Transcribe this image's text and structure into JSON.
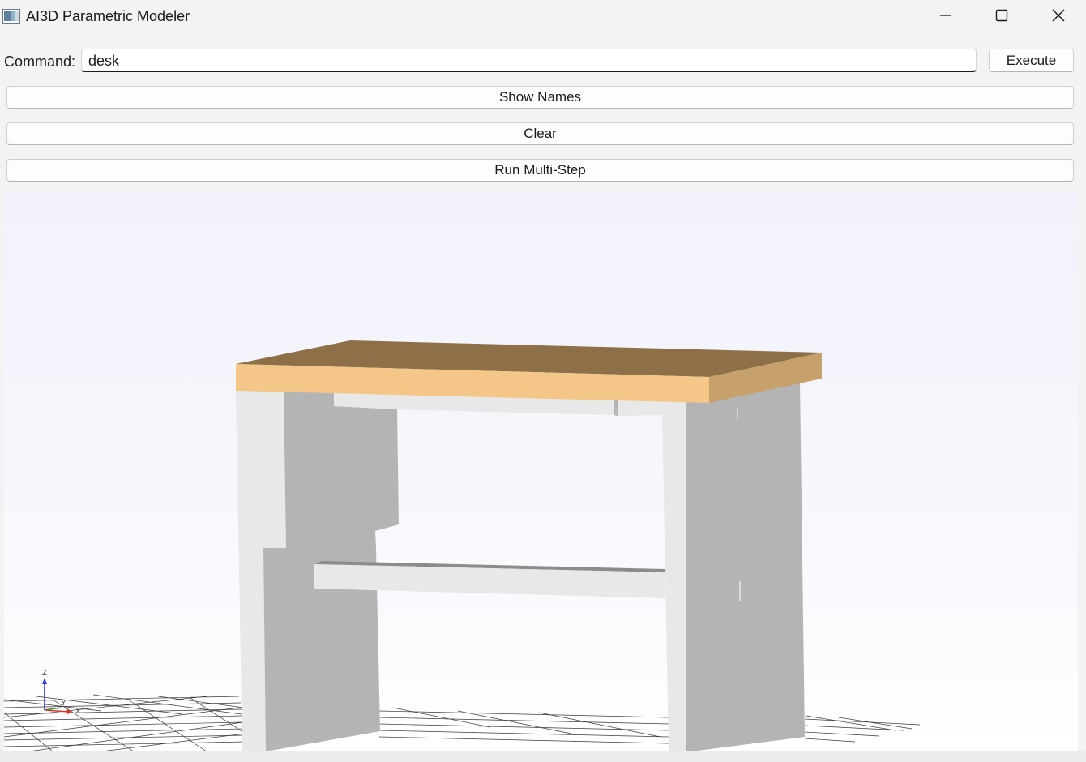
{
  "window": {
    "title": "AI3D Parametric Modeler",
    "icons": {
      "app": "app-icon",
      "minimize": "minimize-icon",
      "maximize": "maximize-icon",
      "close": "close-icon"
    }
  },
  "command": {
    "label": "Command:",
    "value": "desk",
    "execute_label": "Execute"
  },
  "buttons": {
    "show_names": "Show Names",
    "clear": "Clear",
    "run_multi_step": "Run Multi-Step"
  },
  "viewport": {
    "model": "desk",
    "axes": {
      "z": "Z",
      "y": "Y",
      "x": "X"
    },
    "colors": {
      "top_front": "#f4c687",
      "top_upper": "#8d7047",
      "top_side": "#c6a16b",
      "panel_light": "#e8e8e8",
      "panel_shade": "#b4b4b4",
      "grid": "#3a3a3a",
      "axis_x": "#d23a2a",
      "axis_y": "#2a9a3a",
      "axis_z": "#2a3ad2"
    }
  }
}
